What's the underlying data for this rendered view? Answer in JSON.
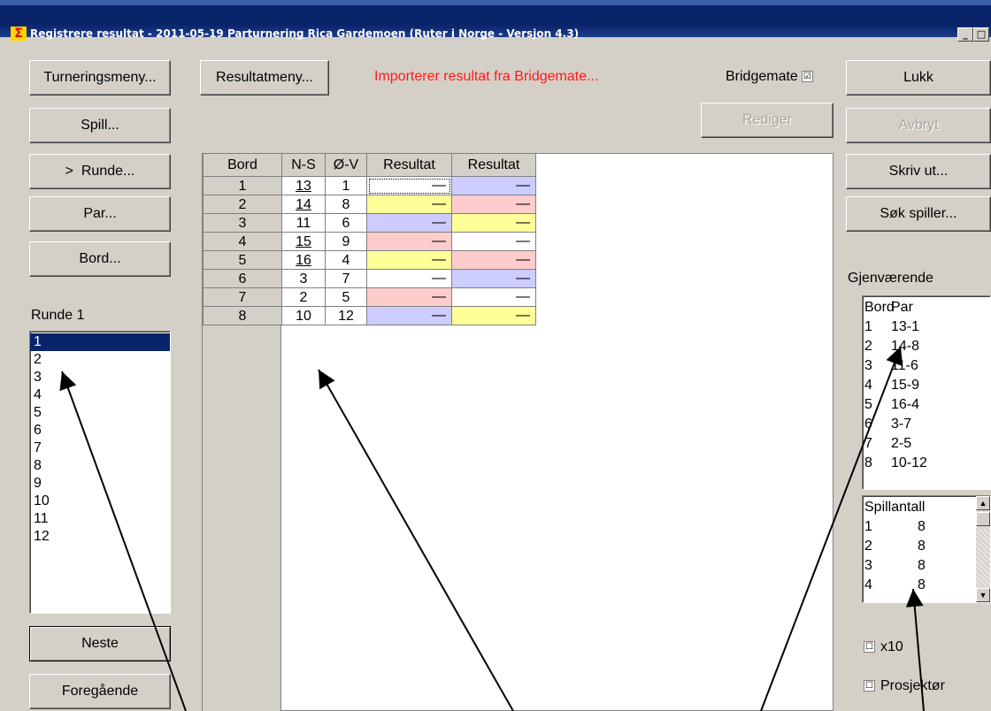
{
  "window": {
    "title": "Registrere resultat - 2011-05-19  Parturnering Rica Gardemoen  (Ruter i Norge - Versjon 4.3)",
    "icon": "sigma-icon",
    "min_label": "_",
    "max_label": "□"
  },
  "left": {
    "buttons": {
      "turneringsmeny": "Turneringsmeny...",
      "spill": "Spill...",
      "runde": ">  Runde...",
      "par": "Par...",
      "bord": "Bord...",
      "neste": "Neste",
      "foregaende": "Foregående"
    },
    "round_label": "Runde 1",
    "rounds": [
      "1",
      "2",
      "3",
      "4",
      "5",
      "6",
      "7",
      "8",
      "9",
      "10",
      "11",
      "12"
    ],
    "selected_round": "1"
  },
  "top": {
    "resultatmeny": "Resultatmeny...",
    "status": "Importerer resultat fra Bridgemate...",
    "bridgemate_label": "Bridgemate",
    "bridgemate_checked": "☑",
    "rediger": "Rediger"
  },
  "grid": {
    "headers": [
      "Bord",
      "N-S",
      "Ø-V",
      "Resultat",
      "Resultat"
    ],
    "rows": [
      {
        "bord": "1",
        "ns": "13",
        "ov": "1",
        "r1": "—",
        "r2": "—"
      },
      {
        "bord": "2",
        "ns": "14",
        "ov": "8",
        "r1": "—",
        "r2": "—"
      },
      {
        "bord": "3",
        "ns": "11",
        "ov": "6",
        "r1": "—",
        "r2": "—"
      },
      {
        "bord": "4",
        "ns": "15",
        "ov": "9",
        "r1": "—",
        "r2": "—"
      },
      {
        "bord": "5",
        "ns": "16",
        "ov": "4",
        "r1": "—",
        "r2": "—"
      },
      {
        "bord": "6",
        "ns": "3",
        "ov": "7",
        "r1": "—",
        "r2": "—"
      },
      {
        "bord": "7",
        "ns": "2",
        "ov": "5",
        "r1": "—",
        "r2": "—"
      },
      {
        "bord": "8",
        "ns": "10",
        "ov": "12",
        "r1": "—",
        "r2": "—"
      }
    ]
  },
  "right": {
    "buttons": {
      "lukk": "Lukk",
      "avbryt": "Avbryt",
      "skriv_ut": "Skriv ut...",
      "sok_spiller": "Søk spiller..."
    },
    "remaining_label": "Gjenværende",
    "remaining_header": {
      "bord": "Bord",
      "par": "Par"
    },
    "remaining": [
      {
        "bord": "1",
        "par": "13-1"
      },
      {
        "bord": "2",
        "par": "14-8"
      },
      {
        "bord": "3",
        "par": "11-6"
      },
      {
        "bord": "4",
        "par": "15-9"
      },
      {
        "bord": "5",
        "par": "16-4"
      },
      {
        "bord": "6",
        "par": "3-7"
      },
      {
        "bord": "7",
        "par": "2-5"
      },
      {
        "bord": "8",
        "par": "10-12"
      }
    ],
    "spillantall_label": "Spillantall",
    "spillantall": [
      {
        "round": "1",
        "count": "8"
      },
      {
        "round": "2",
        "count": "8"
      },
      {
        "round": "3",
        "count": "8"
      },
      {
        "round": "4",
        "count": "8"
      }
    ],
    "x10_label": "x10",
    "prosjektor_label": "Prosjektør",
    "unchecked": "☐"
  }
}
